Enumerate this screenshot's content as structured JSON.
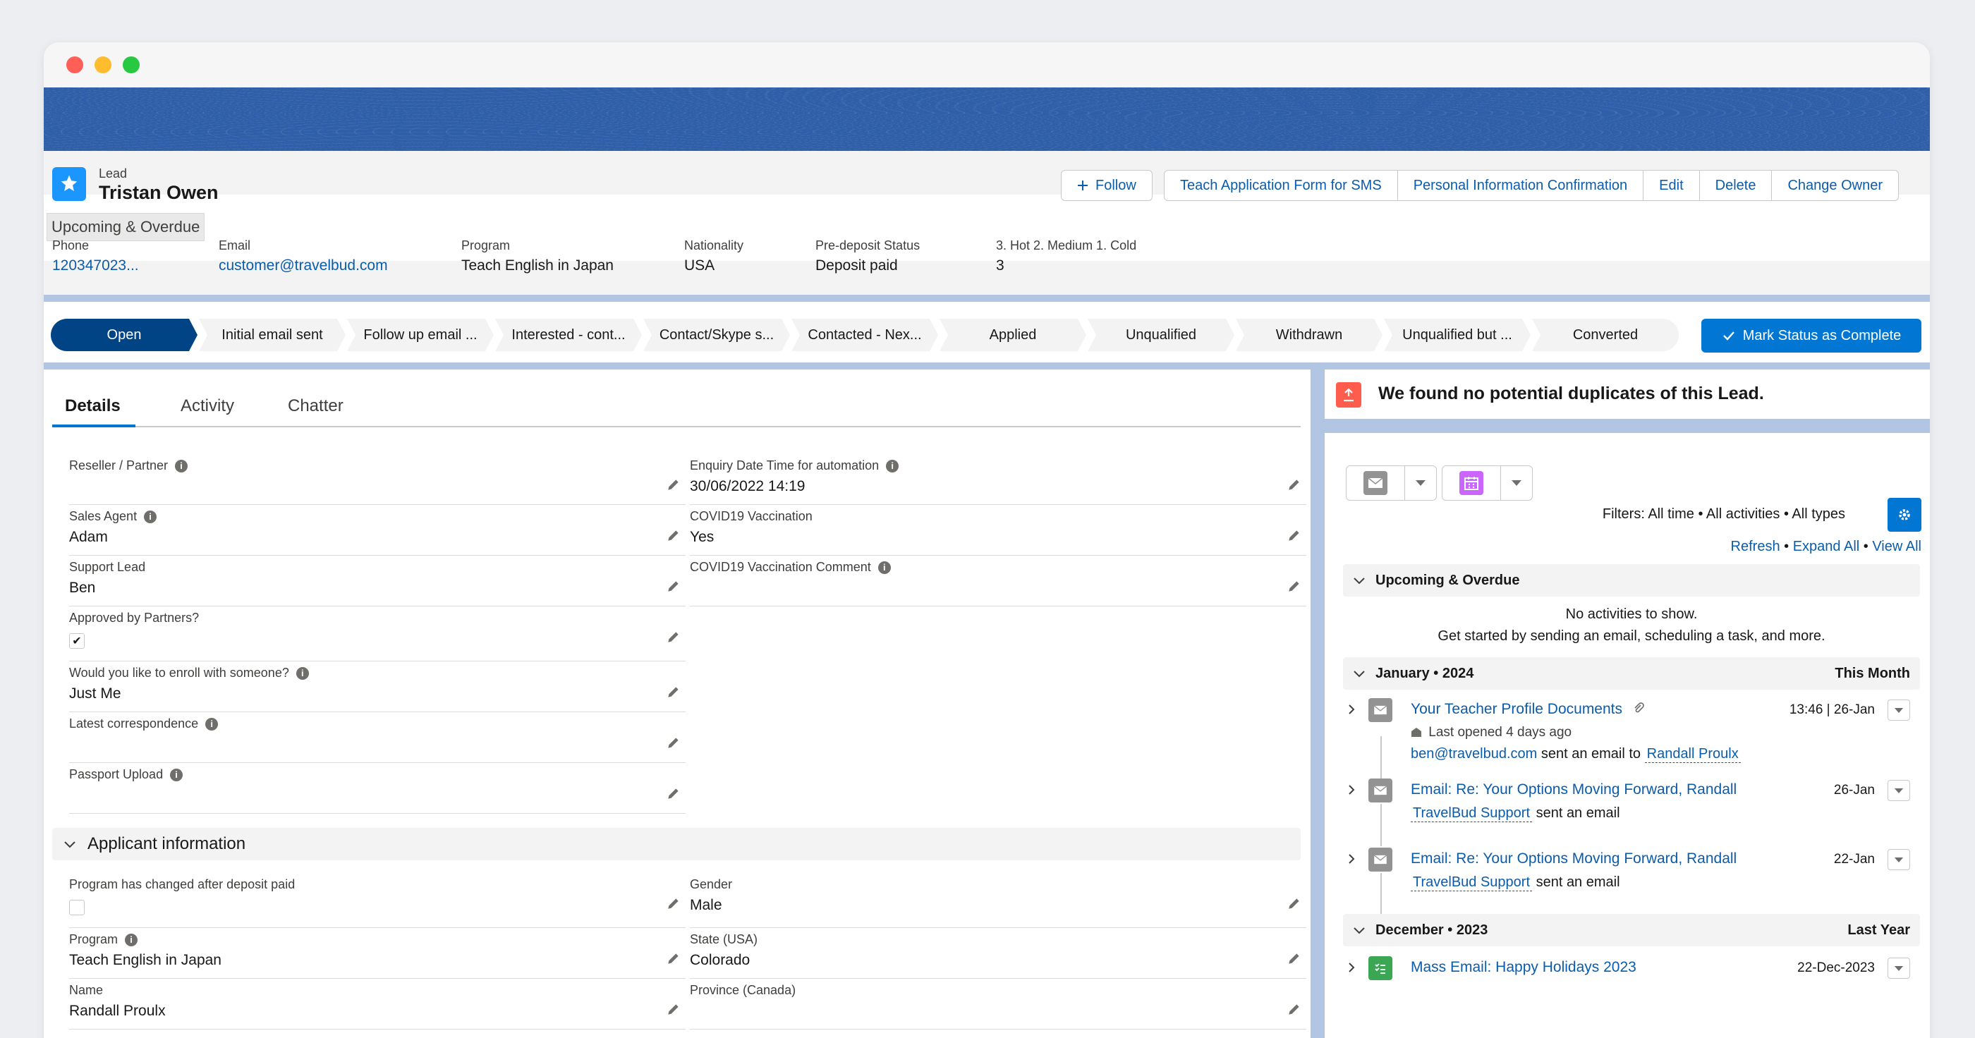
{
  "record": {
    "object_label": "Lead",
    "name": "Tristan Owen",
    "tooltip": "Upcoming & Overdue"
  },
  "actions": {
    "follow": "Follow",
    "teach_form": "Teach Application Form for SMS",
    "personal_info": "Personal Information Confirmation",
    "edit": "Edit",
    "delete": "Delete",
    "change_owner": "Change Owner"
  },
  "highlights": [
    {
      "label": "Phone",
      "value": "120347023..."
    },
    {
      "label": "Email",
      "value": "customer@travelbud.com"
    },
    {
      "label": "Program",
      "value": "Teach English in Japan"
    },
    {
      "label": "Nationality",
      "value": "USA"
    },
    {
      "label": "Pre-deposit Status",
      "value": "Deposit paid"
    },
    {
      "label": "3. Hot 2. Medium 1. Cold",
      "value": "3"
    }
  ],
  "path": {
    "stages": [
      "Open",
      "Initial email sent",
      "Follow up email ...",
      "Interested - cont...",
      "Contact/Skype s...",
      "Contacted - Nex...",
      "Applied",
      "Unqualified",
      "Withdrawn",
      "Unqualified but ...",
      "Converted"
    ],
    "mark_complete": "Mark Status as Complete"
  },
  "tabs": [
    "Details",
    "Activity",
    "Chatter"
  ],
  "details": {
    "left": [
      {
        "label": "Reseller / Partner",
        "value": "",
        "info": true
      },
      {
        "label": "Sales Agent",
        "value": "Adam",
        "info": true
      },
      {
        "label": "Support Lead",
        "value": "Ben",
        "info": false
      },
      {
        "label": "Approved by Partners?",
        "value": "",
        "info": false
      },
      {
        "label": "Would you like to enroll with someone?",
        "value": "Just Me",
        "info": true
      },
      {
        "label": "Latest correspondence",
        "value": "",
        "info": true
      },
      {
        "label": "Passport Upload",
        "value": "",
        "info": true
      }
    ],
    "right": [
      {
        "label": "Enquiry Date Time for automation",
        "value": "30/06/2022 14:19",
        "info": true
      },
      {
        "label": "COVID19 Vaccination",
        "value": "Yes",
        "info": false
      },
      {
        "label": "COVID19 Vaccination Comment",
        "value": "",
        "info": true
      }
    ]
  },
  "applicant": {
    "title": "Applicant information",
    "left": [
      {
        "label": "Program has changed after deposit paid",
        "value": "",
        "info": false
      },
      {
        "label": "Program",
        "value": "Teach English in Japan",
        "info": true
      },
      {
        "label": "Name",
        "value": "Randall Proulx",
        "info": false
      }
    ],
    "right": [
      {
        "label": "Gender",
        "value": "Male",
        "info": false
      },
      {
        "label": "State (USA)",
        "value": "Colorado",
        "info": false
      },
      {
        "label": "Province (Canada)",
        "value": "",
        "info": false
      }
    ]
  },
  "duplicates": {
    "message": "We found no potential duplicates of this Lead."
  },
  "activity": {
    "filters": "Filters: All time • All activities • All types",
    "refresh": "Refresh",
    "expand_all": "Expand All",
    "view_all": "View All",
    "upcoming": {
      "title": "Upcoming & Overdue",
      "empty_line1": "No activities to show.",
      "empty_line2": "Get started by sending an email, scheduling a task, and more."
    },
    "jan": {
      "title": "January • 2024",
      "right": "This Month",
      "items": [
        {
          "title": "Your Teacher Profile Documents",
          "date": "13:46 | 26-Jan",
          "opened": "Last opened 4 days ago",
          "from": "ben@travelbud.com",
          "action": "sent an email to",
          "to": "Randall Proulx"
        },
        {
          "title": "Email: Re: Your Options Moving Forward, Randall",
          "date": "26-Jan",
          "from": "TravelBud Support",
          "action": "sent an email"
        },
        {
          "title": "Email: Re: Your Options Moving Forward, Randall",
          "date": "22-Jan",
          "from": "TravelBud Support",
          "action": "sent an email"
        }
      ]
    },
    "dec": {
      "title": "December • 2023",
      "right": "Last Year",
      "items": [
        {
          "title": "Mass Email: Happy Holidays 2023",
          "date": "22-Dec-2023"
        }
      ]
    }
  },
  "colors": {
    "brand": "#0176d3",
    "path_active": "#014486",
    "link": "#0b5cab"
  }
}
